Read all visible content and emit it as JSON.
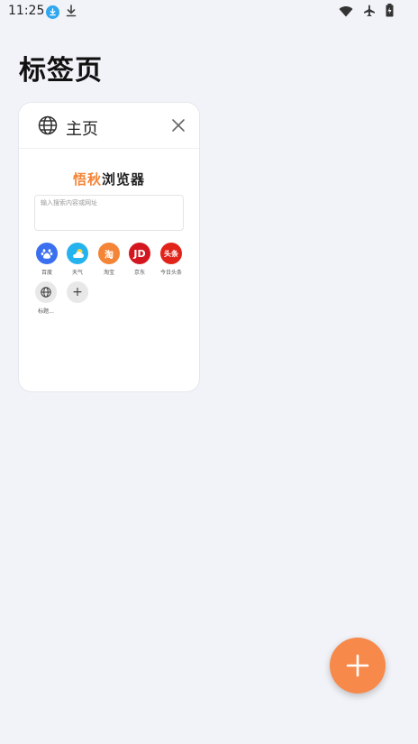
{
  "status_bar": {
    "time": "11:25",
    "left_icons": [
      "download-badge-icon",
      "download-icon"
    ],
    "right_icons": [
      "wifi-icon",
      "airplane-icon",
      "battery-icon"
    ]
  },
  "page": {
    "title": "标签页"
  },
  "tab": {
    "title": "主页",
    "icon": "globe-icon",
    "preview": {
      "brand_part1": "悟秋",
      "brand_part2": "浏览器",
      "search_placeholder": "输入搜索内容或网址",
      "shortcuts": [
        {
          "label": "百度",
          "glyph": "🐾",
          "color": "#3a6ff0",
          "icon": "baidu-icon"
        },
        {
          "label": "天气",
          "glyph": "⛅",
          "color": "#25b3f0",
          "icon": "weather-icon"
        },
        {
          "label": "淘宝",
          "glyph": "淘",
          "color": "#f48436",
          "icon": "taobao-icon"
        },
        {
          "label": "京东",
          "glyph": "JD",
          "color": "#d4171e",
          "icon": "jd-icon"
        },
        {
          "label": "今日头条",
          "glyph": "头条",
          "color": "#e2231a",
          "icon": "toutiao-icon"
        },
        {
          "label": "标题...",
          "glyph": "",
          "color": "#e8e8e8",
          "icon": "globe-icon"
        },
        {
          "label": "",
          "glyph": "+",
          "color": "#e8e8e8",
          "icon": "add-icon"
        }
      ]
    }
  },
  "fab": {
    "icon": "plus-icon",
    "color": "#f7894a"
  }
}
